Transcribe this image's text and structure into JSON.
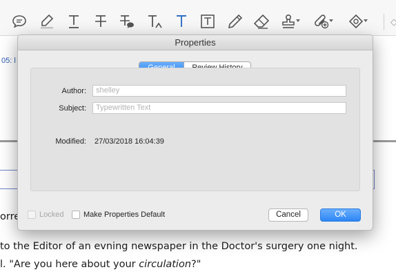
{
  "toolbar": {
    "tools": [
      "comment-icon",
      "highlight-icon",
      "underline-text-icon",
      "strikethrough-text-icon",
      "replace-text-icon",
      "insert-text-icon",
      "typewriter-text-icon",
      "text-box-icon",
      "pencil-icon",
      "eraser-icon",
      "stamp-icon",
      "attach-icon",
      "shape-icon"
    ]
  },
  "document": {
    "link_fragment": "05: l",
    "partial_word": "orrec",
    "line1": "to the Editor of an evning newspaper in the Doctor's surgery one night.",
    "line2_pre": "l. \"Are you here about your ",
    "line2_em": "circulation",
    "line2_post": "?\""
  },
  "dialog": {
    "title": "Properties",
    "tabs": [
      {
        "label": "General",
        "active": true
      },
      {
        "label": "Review History",
        "active": false
      }
    ],
    "author_label": "Author:",
    "author_placeholder": "shelley",
    "subject_label": "Subject:",
    "subject_placeholder": "Typewritten Text",
    "modified_label": "Modified:",
    "modified_value": "27/03/2018 16:04:39",
    "locked_label": "Locked",
    "make_default_label": "Make Properties Default",
    "cancel_label": "Cancel",
    "ok_label": "OK"
  },
  "colors": {
    "accent": "#2d86f5",
    "link": "#2a5db0",
    "dialog_bg": "#ececec"
  }
}
